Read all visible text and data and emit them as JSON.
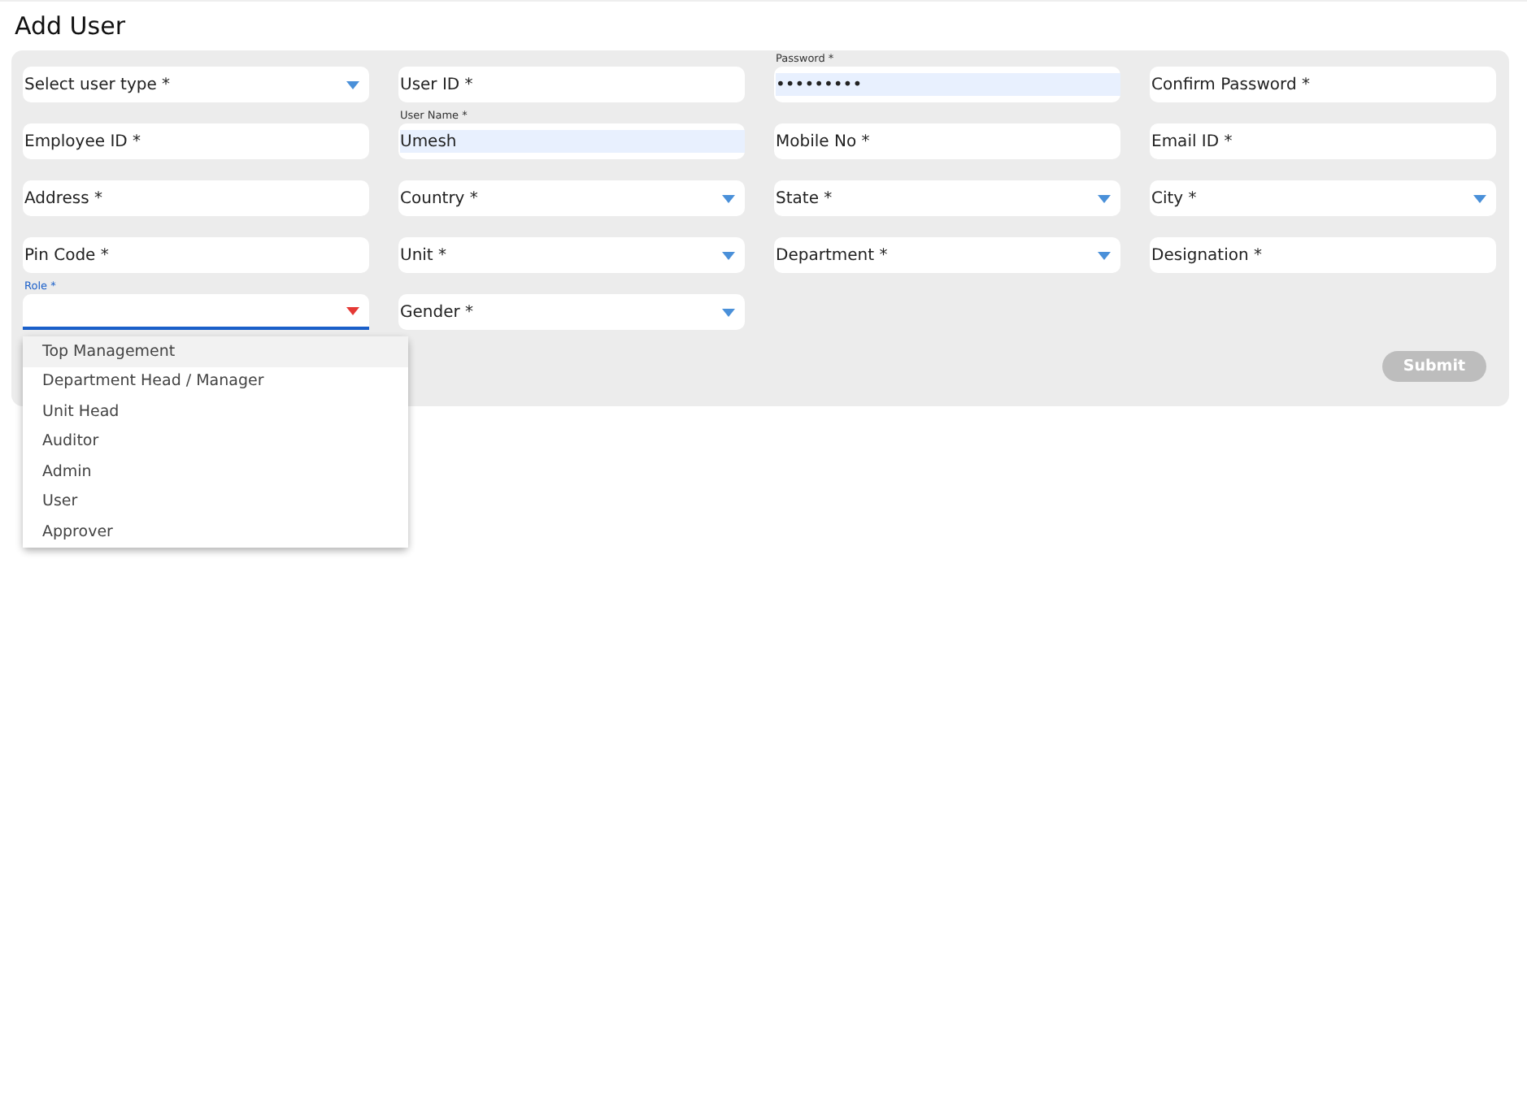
{
  "title": "Add User",
  "fields": [
    {
      "kind": "select",
      "label": "Select user type *"
    },
    {
      "kind": "text",
      "label": "User ID *"
    },
    {
      "kind": "text",
      "label": "Password *",
      "value": "•••••••••"
    },
    {
      "kind": "text",
      "label": "Confirm Password *"
    },
    {
      "kind": "text",
      "label": "Employee ID *"
    },
    {
      "kind": "text",
      "label": "User Name *",
      "value": "Umesh"
    },
    {
      "kind": "text",
      "label": "Mobile No *"
    },
    {
      "kind": "text",
      "label": "Email ID *"
    },
    {
      "kind": "text",
      "label": "Address *"
    },
    {
      "kind": "select",
      "label": "Country *"
    },
    {
      "kind": "select",
      "label": "State *"
    },
    {
      "kind": "select",
      "label": "City *"
    },
    {
      "kind": "text",
      "label": "Pin Code *"
    },
    {
      "kind": "select",
      "label": "Unit *"
    },
    {
      "kind": "select",
      "label": "Department *"
    },
    {
      "kind": "text",
      "label": "Designation *"
    },
    {
      "kind": "select",
      "label": "Role *",
      "focused": true,
      "options": [
        {
          "label": "Top Management",
          "highlighted": true
        },
        {
          "label": "Department Head / Manager",
          "highlighted": false
        },
        {
          "label": "Unit Head",
          "highlighted": false
        },
        {
          "label": "Auditor",
          "highlighted": false
        },
        {
          "label": "Admin",
          "highlighted": false
        },
        {
          "label": "User",
          "highlighted": false
        },
        {
          "label": "Approver",
          "highlighted": false
        }
      ]
    },
    {
      "kind": "select",
      "label": "Gender *"
    }
  ],
  "submit": {
    "label": "Submit",
    "disabled": true
  }
}
